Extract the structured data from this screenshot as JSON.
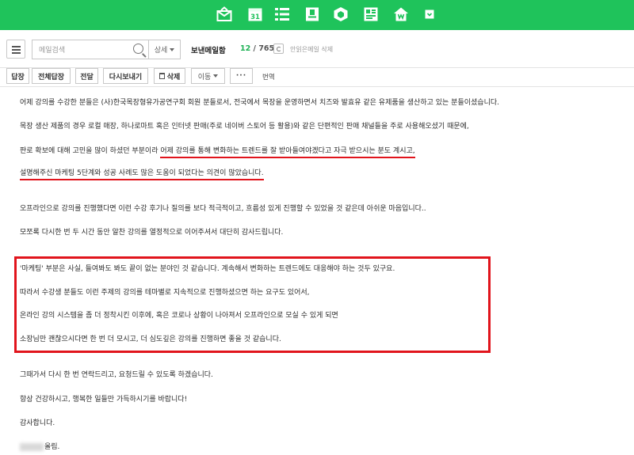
{
  "topbar": {
    "apps": [
      {
        "icon": "mail-icon"
      },
      {
        "icon": "calendar-icon",
        "label": "31"
      },
      {
        "icon": "list-icon"
      },
      {
        "icon": "contacts-icon"
      },
      {
        "icon": "cube-icon"
      },
      {
        "icon": "note-icon"
      },
      {
        "icon": "home-icon"
      },
      {
        "icon": "more-apps-icon"
      }
    ],
    "color": "#1fc35b"
  },
  "search": {
    "placeholder": "메일검색",
    "detail_label": "상세"
  },
  "folder": {
    "name": "보낸메일함",
    "unread": "12",
    "total": "/ 765",
    "delete_read": "안읽은메일 삭제"
  },
  "actions": {
    "reply": "답장",
    "reply_all": "전체답장",
    "forward": "전달",
    "resend": "다시보내기",
    "delete": "삭제",
    "move": "이동",
    "more": "···",
    "translate": "번역"
  },
  "message": {
    "line1": "어제 강의를 수강한 분들은 (사)한국목장형유가공연구회 회원 분들로서, 전국에서 목장을 운영하면서 치즈와 발효유 같은 유제품을 생산하고 있는 분들이셨습니다.",
    "line2": "목장 생산 제품의 경우 로컬 매장, 하나로마트 혹은 인터넷 판매(주로 네이버 스토어 등 활용)와 같은 단편적인 판매 채널들을 주로 사용해오셨기 때문에,",
    "line3a": "판로 확보에 대해 고민을 많이 하셨던 부분이라 ",
    "line3b": "어제 강의를 통해 변화하는 트렌드를 잘 받아들여야겠다고 자극 받으시는 분도 계시고,",
    "line4": "설명해주신 마케팅 5단계와 성공 사례도  많은 도움이 되었다는 의견이 많았습니다.",
    "line5": "오프라인으로 강의를 진행했다면 이런 수강 후기나 질의를 보다 적극적이고, 흐름성 있게 진행할 수 있었을 것 같은데 아쉬운 마음입니다..",
    "line6": "모쪼록 다시한 번 두 시간 동안 알찬 강의를 열정적으로 이어주셔서 대단히 감사드립니다.",
    "line7": "'마케팅' 부분은 사실, 들여봐도 봐도 끝이 없는 분야인 것 같습니다. 계속해서 변화하는 트렌드에도 대응해야 하는 것두 있구요.",
    "line8": "따라서 수강생 분들도 이런 주제의 강의를 테마별로 지속적으로 진행하셨으면 하는 요구도 있어서,",
    "line9": "온라인 강의 시스템을 좀 더 정착시킨 이후에, 혹은 코로나 상황이 나아져서 오프라인으로 모실 수 있게 되면",
    "line10": "소장님만 괜찮으시다면 한 번 더 모시고, 더 심도깊은 강의를 진행하면 좋을 것 같습니다.",
    "line11": "그때가서 다시 한 번 연락드리고, 요청드릴 수 있도록 하겠습니다.",
    "line12": "항상 건강하시고, 행복한 일들만 가득하시기를 바랍니다!",
    "line13": "감사합니다.",
    "signature": "올림."
  },
  "colors": {
    "accent_green": "#1fc35b",
    "highlight_red": "#e1141c",
    "unread_green": "#1fb155"
  }
}
